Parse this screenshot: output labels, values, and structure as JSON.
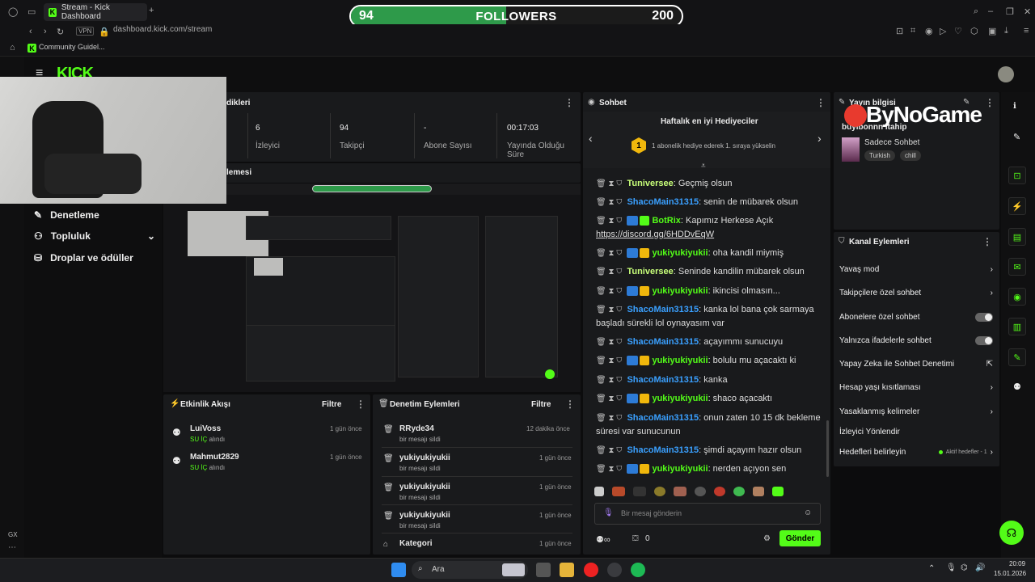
{
  "browser": {
    "tab_title": "Stream - Kick Dashboard",
    "url": "dashboard.kick.com/stream",
    "vpn": "VPN",
    "bookmark": "Community Guidel..."
  },
  "overlay": {
    "followers_current": "94",
    "followers_label": "FOLLOWERS",
    "followers_goal": "200",
    "followers_progress": 0.47,
    "logo_text": "ByNoGame"
  },
  "sidebar": {
    "items": [
      {
        "label": "Denetleme"
      },
      {
        "label": "Topluluk"
      },
      {
        "label": "Droplar ve ödüller"
      }
    ]
  },
  "stats": {
    "header": "dikleri",
    "items": [
      {
        "value": "6",
        "label": "İzleyici"
      },
      {
        "value": "94",
        "label": "Takipçi"
      },
      {
        "value": "-",
        "label": "Abone Sayısı"
      },
      {
        "value": "00:17:03",
        "label": "Yayında Olduğu Süre"
      }
    ]
  },
  "preview": {
    "header": "lemesi"
  },
  "activity": {
    "title": "Etkinlik Akışı",
    "filter": "Filtre",
    "items": [
      {
        "user": "LuiVoss",
        "action_a": "SU İÇ",
        "action_b": " alındı",
        "time": "1 gün önce"
      },
      {
        "user": "Mahmut2829",
        "action_a": "SU İÇ",
        "action_b": " alındı",
        "time": "1 gün önce"
      }
    ]
  },
  "moderation": {
    "title": "Denetim Eylemleri",
    "filter": "Filtre",
    "items": [
      {
        "user": "RRyde34",
        "desc": "bir mesajı sildi",
        "time": "12 dakika önce"
      },
      {
        "user": "yukiyukiyukii",
        "desc": "bir mesajı sildi",
        "time": "1 gün önce"
      },
      {
        "user": "yukiyukiyukii",
        "desc": "bir mesajı sildi",
        "time": "1 gün önce"
      },
      {
        "user": "yukiyukiyukii",
        "desc": "bir mesajı sildi",
        "time": "1 gün önce"
      },
      {
        "user": "Kategori",
        "desc": "",
        "time": "1 gün önce"
      }
    ]
  },
  "chat": {
    "title": "Sohbet",
    "top_gifters_title": "Haftalık en iyi Hediyeciler",
    "top_gifters_rank": "1",
    "top_gifters_text": "1 abonelik hediye ederek 1. sıraya yükselin",
    "messages": [
      {
        "user": "Tuniversee",
        "text": ": Geçmiş olsun",
        "style": "u3"
      },
      {
        "user": "ShacoMain31315",
        "text": ": senin de mübarek olsun",
        "style": "u1"
      },
      {
        "user": "BotRix",
        "text": ": Kapımız Herkese Açık",
        "link": "https://discord.gg/6HDDvEqW",
        "style": "u2"
      },
      {
        "user": "yukiyukiyukii",
        "text": ": oha kandil miymiş",
        "style": "u2"
      },
      {
        "user": "Tuniversee",
        "text": ": Seninde kandilin mübarek olsun",
        "style": "u3"
      },
      {
        "user": "yukiyukiyukii",
        "text": ": ikincisi olmasın...",
        "style": "u2"
      },
      {
        "user": "ShacoMain31315",
        "text": ": kanka lol bana çok sarmaya başladı sürekli lol oynayasım var",
        "style": "u1"
      },
      {
        "user": "ShacoMain31315",
        "text": ": açayımmı sunucuyu",
        "style": "u1"
      },
      {
        "user": "yukiyukiyukii",
        "text": ": bolulu mu açacaktı ki",
        "style": "u2"
      },
      {
        "user": "ShacoMain31315",
        "text": ": kanka",
        "style": "u1"
      },
      {
        "user": "yukiyukiyukii",
        "text": ": shaco açacaktı",
        "style": "u2"
      },
      {
        "user": "ShacoMain31315",
        "text": ": onun zaten 10 15 dk bekleme süresi var sunucunun",
        "style": "u1"
      },
      {
        "user": "ShacoMain31315",
        "text": ": şimdi açayım hazır olsun",
        "style": "u1"
      },
      {
        "user": "yukiyukiyukii",
        "text": ": nerden açıyon sen",
        "style": "u2"
      }
    ],
    "input_placeholder": "Bir mesaj gönderin",
    "counter": "0",
    "send_label": "Gönder"
  },
  "stream_info": {
    "title": "Yayın bilgisi",
    "stream_title": "buyibonnn itahip",
    "mode": "Sadece Sohbet",
    "tags": [
      "Turkish",
      "chill"
    ]
  },
  "channel_actions": {
    "title": "Kanal Eylemleri",
    "items": [
      {
        "label": "Yavaş mod"
      },
      {
        "label": "Takipçilere özel sohbet"
      },
      {
        "label": "Abonelere özel sohbet"
      },
      {
        "label": "Yalnızca ifadelerle sohbet"
      },
      {
        "label": "Yapay Zeka ile Sohbet Denetimi"
      },
      {
        "label": "Hesap yaşı kısıtlaması"
      },
      {
        "label": "Yasaklanmış kelimeler"
      },
      {
        "label": "İzleyici Yönlendir"
      },
      {
        "label": "Hedefleri belirleyin"
      }
    ],
    "goals_status": "Aktif hedefler - 1"
  },
  "taskbar": {
    "search": "Ara",
    "time": "20:09",
    "date": "15.01.2026"
  },
  "colors": {
    "accent": "#53fc18",
    "panel": "#191a1c",
    "background": "#0c0c0d"
  }
}
